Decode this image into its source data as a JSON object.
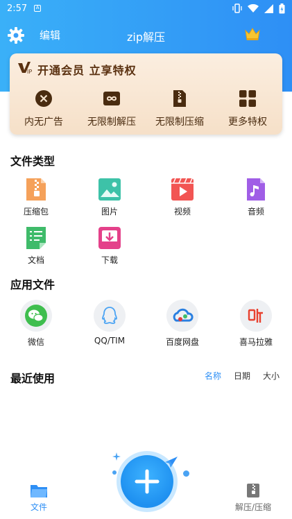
{
  "status_bar": {
    "time": "2:57",
    "notification_letter": "A"
  },
  "header": {
    "edit_label": "编辑",
    "title": "zip解压"
  },
  "vip_card": {
    "headline": "开通会员 立享特权",
    "perks": [
      {
        "label": "内无广告",
        "icon": "no-ads-icon"
      },
      {
        "label": "无限制解压",
        "icon": "infinity-icon"
      },
      {
        "label": "无限制压缩",
        "icon": "zip-file-icon"
      },
      {
        "label": "更多特权",
        "icon": "grid-icon"
      }
    ]
  },
  "file_types": {
    "title": "文件类型",
    "items": [
      {
        "label": "压缩包",
        "icon": "archive-icon"
      },
      {
        "label": "图片",
        "icon": "image-icon"
      },
      {
        "label": "视频",
        "icon": "video-icon"
      },
      {
        "label": "音频",
        "icon": "audio-icon"
      },
      {
        "label": "文档",
        "icon": "document-icon"
      },
      {
        "label": "下载",
        "icon": "download-icon"
      }
    ]
  },
  "app_files": {
    "title": "应用文件",
    "items": [
      {
        "label": "微信",
        "icon": "wechat-icon"
      },
      {
        "label": "QQ/TIM",
        "icon": "qq-icon"
      },
      {
        "label": "百度网盘",
        "icon": "baidu-netdisk-icon"
      },
      {
        "label": "喜马拉雅",
        "icon": "ximalaya-icon"
      }
    ]
  },
  "recent": {
    "title": "最近使用",
    "sort_options": [
      "名称",
      "日期",
      "大小"
    ],
    "active_sort": "名称"
  },
  "bottom_nav": {
    "files_label": "文件",
    "zip_label": "解压/压缩"
  },
  "colors": {
    "primary": "#2e8ff5",
    "vip_text": "#5a3110"
  }
}
